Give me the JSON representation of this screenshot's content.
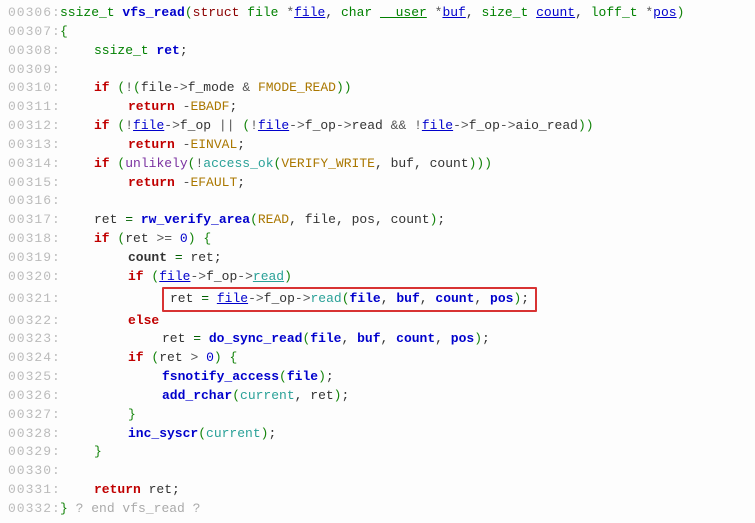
{
  "lines": {
    "l306_num": "00306:",
    "l307_num": "00307:",
    "l308_num": "00308:",
    "l309_num": "00309:",
    "l310_num": "00310:",
    "l311_num": "00311:",
    "l312_num": "00312:",
    "l313_num": "00313:",
    "l314_num": "00314:",
    "l315_num": "00315:",
    "l316_num": "00316:",
    "l317_num": "00317:",
    "l318_num": "00318:",
    "l319_num": "00319:",
    "l320_num": "00320:",
    "l321_num": "00321:",
    "l322_num": "00322:",
    "l323_num": "00323:",
    "l324_num": "00324:",
    "l325_num": "00325:",
    "l326_num": "00326:",
    "l327_num": "00327:",
    "l328_num": "00328:",
    "l329_num": "00329:",
    "l330_num": "00330:",
    "l331_num": "00331:",
    "l332_num": "00332:"
  },
  "tokens": {
    "ssize_t": "ssize_t",
    "vfs_read": "vfs_read",
    "struct": "struct",
    "file": "file",
    "char": "char",
    "user": "__user",
    "buf": "buf",
    "size_t": "size_t",
    "count": "count",
    "loff_t": "loff_t",
    "pos": "pos",
    "ret": "ret",
    "if": "if",
    "else": "else",
    "return": "return",
    "f_mode": "f_mode",
    "FMODE_READ": "FMODE_READ",
    "EBADF": "EBADF",
    "f_op": "f_op",
    "read": "read",
    "aio_read": "aio_read",
    "EINVAL": "EINVAL",
    "unlikely": "unlikely",
    "access_ok": "access_ok",
    "VERIFY_WRITE": "VERIFY_WRITE",
    "EFAULT": "EFAULT",
    "rw_verify_area": "rw_verify_area",
    "READ": "READ",
    "zero": "0",
    "do_sync_read": "do_sync_read",
    "fsnotify_access": "fsnotify_access",
    "add_rchar": "add_rchar",
    "current": "current",
    "inc_syscr": "inc_syscr",
    "end_comment": "? end vfs_read ?",
    "arrow": "->",
    "star": "*",
    "amp": "&",
    "bang": "!",
    "ge": ">=",
    "gt": ">",
    "eq": "=",
    "or": "||",
    "and": "&&",
    "sc": ";",
    "comma": ",",
    "lp": "(",
    "rp": ")",
    "lb": "{",
    "rb": "}",
    "minus": "-"
  }
}
